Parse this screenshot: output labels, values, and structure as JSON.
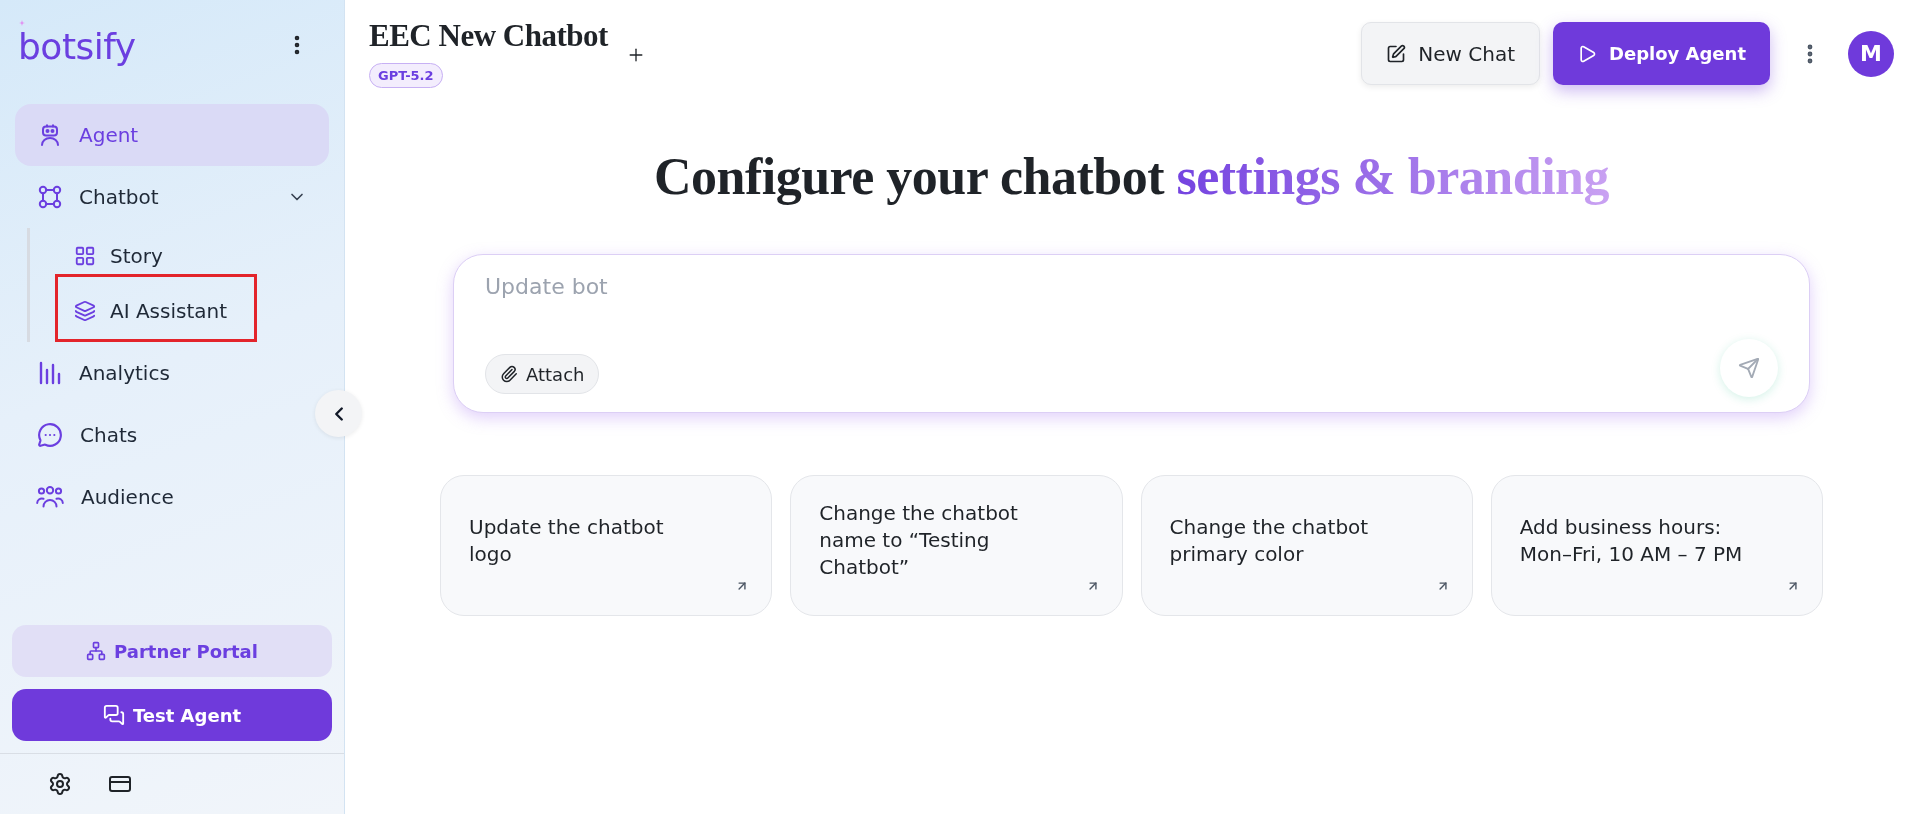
{
  "sidebar": {
    "brand": "botsify",
    "nav": [
      {
        "kind": "link",
        "label": "Agent",
        "selected": true
      },
      {
        "kind": "group",
        "label": "Chatbot",
        "selected": false,
        "expanded": true,
        "children": [
          {
            "label": "Story",
            "selected": false,
            "highlighted": false
          },
          {
            "label": "AI Assistant",
            "selected": false,
            "highlighted": true
          }
        ]
      },
      {
        "kind": "link",
        "label": "Analytics",
        "selected": false
      },
      {
        "kind": "link",
        "label": "Chats",
        "selected": false
      },
      {
        "kind": "link",
        "label": "Audience",
        "selected": false
      }
    ],
    "partner_button": "Partner Portal",
    "test_button": "Test Agent"
  },
  "header": {
    "title": "EEC New Chatbot",
    "badge": "GPT-5.2",
    "new_chat": "New Chat",
    "deploy": "Deploy Agent",
    "avatar": "M"
  },
  "heading": {
    "text": "Configure your chatbot",
    "highlight": "settings & branding"
  },
  "composer": {
    "placeholder": "Update bot",
    "attach": "Attach"
  },
  "suggestions": [
    "Update the chatbot logo",
    "Change the chatbot name to “Testing Chatbot”",
    "Change the chatbot primary color",
    "Add business hours: Mon–Fri, 10 AM – 7 PM"
  ]
}
